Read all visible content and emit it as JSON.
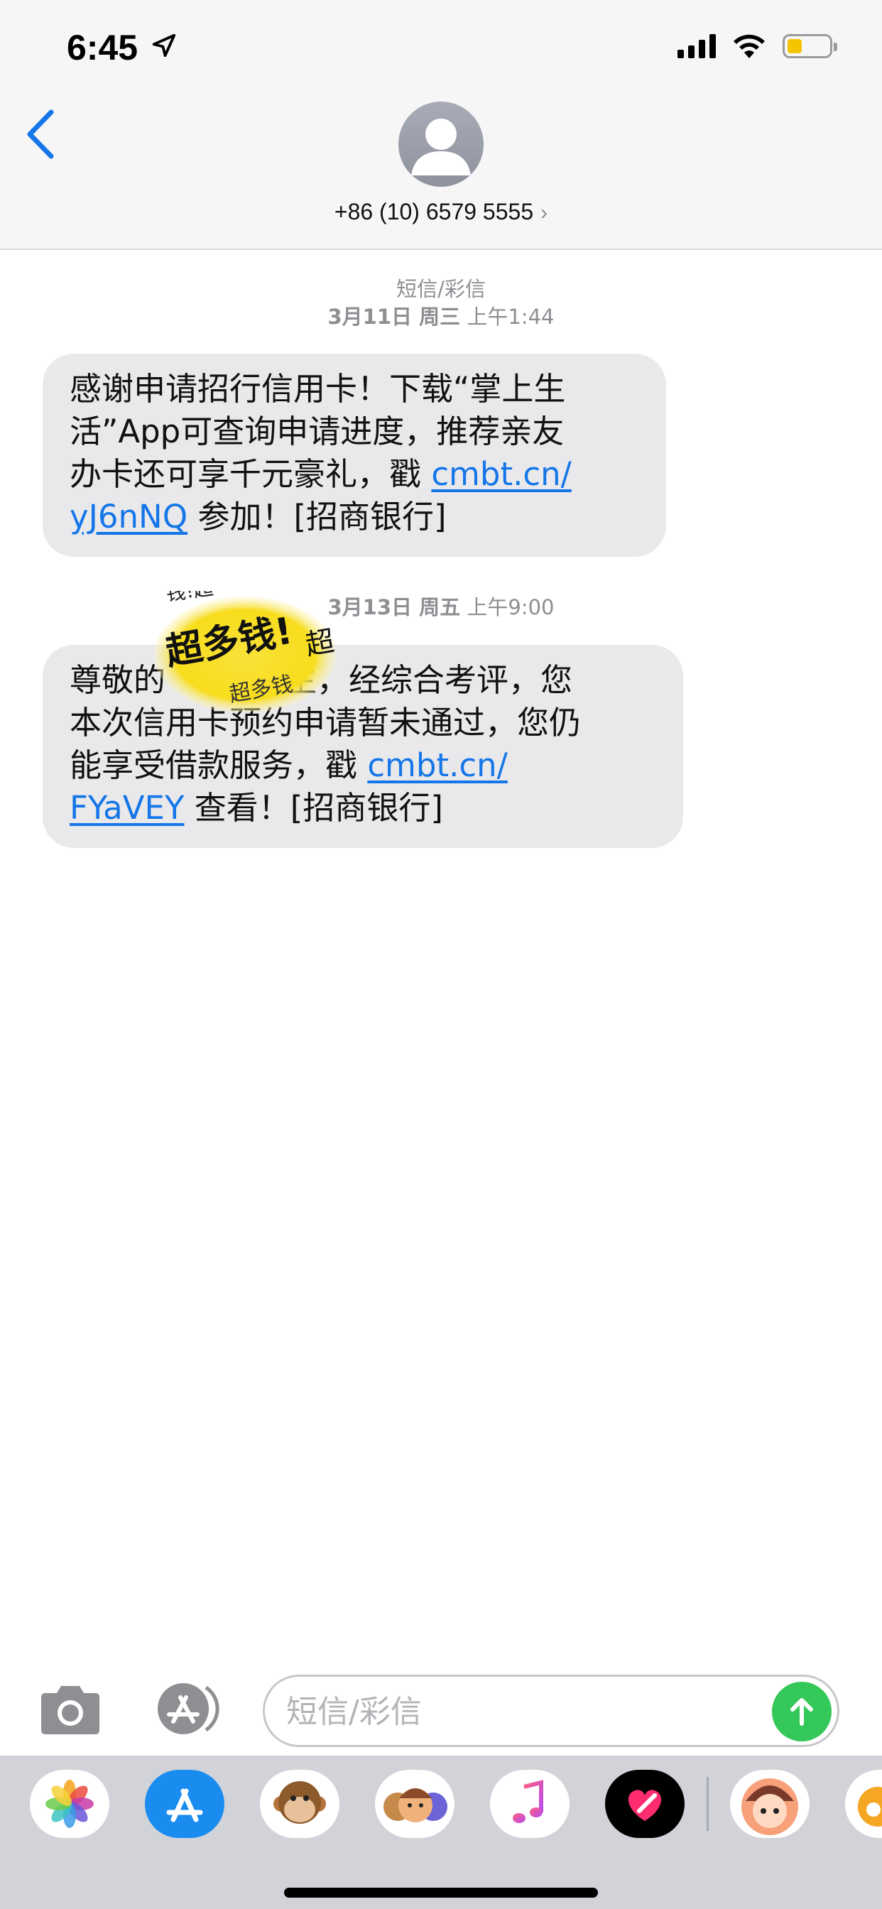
{
  "status_bar": {
    "time": "6:45",
    "location_icon": "location-arrow-icon",
    "signal_icon": "cellular-signal-icon",
    "wifi_icon": "wifi-icon",
    "battery_icon": "battery-icon",
    "battery_level": 0.35,
    "battery_color": "#f5c400"
  },
  "header": {
    "back_icon": "chevron-left-icon",
    "avatar_icon": "person-avatar-icon",
    "contact": "+86 (10) 6579 5555",
    "contact_chevron": "›"
  },
  "thread": {
    "groups": [
      {
        "service": "短信/彩信",
        "date_bold": "3月11日 周三",
        "date_time": " 上午1:44"
      },
      {
        "service": "",
        "date_bold": "3月13日 周五",
        "date_time": " 上午9:00"
      }
    ],
    "messages": [
      {
        "line1": "感谢申请招行信用卡！下载“掌上生",
        "line2": "活”App可查询申请进度，推荐亲友",
        "line3_text": "办卡还可享千元豪礼，戳 ",
        "link_part1": "cmbt.cn/",
        "link_part2": "yJ6nNQ",
        "line4_text": " 参加！[招商银行]"
      },
      {
        "line1_a": "尊敬的",
        "line1_b": "生，经综合考评，您",
        "line2": "本次信用卡预约申请暂未通过，您仍",
        "line3_text": "能享受借款服务，戳 ",
        "link_part1": "cmbt.cn/",
        "link_part2": "FYaVEY",
        "line4_text": " 查看！[招商银行]"
      }
    ],
    "sticker": {
      "text_main": "超多钱!",
      "text_top": "钱!超",
      "text_bottom": "超多钱",
      "text_right": "超",
      "color": "#f7dd1c"
    }
  },
  "compose": {
    "camera_icon": "camera-icon",
    "app_store_icon": "app-store-icon",
    "placeholder": "短信/彩信",
    "send_icon": "arrow-up-icon",
    "send_color": "#34c759"
  },
  "drawer": {
    "apps": [
      {
        "name": "photos-app-icon"
      },
      {
        "name": "app-store-app-icon"
      },
      {
        "name": "animoji-monkey-icon"
      },
      {
        "name": "memoji-stickers-icon"
      },
      {
        "name": "music-app-icon"
      },
      {
        "name": "digital-touch-icon"
      },
      {
        "name": "sticker-app-girl-icon"
      },
      {
        "name": "weibo-app-icon"
      }
    ]
  }
}
